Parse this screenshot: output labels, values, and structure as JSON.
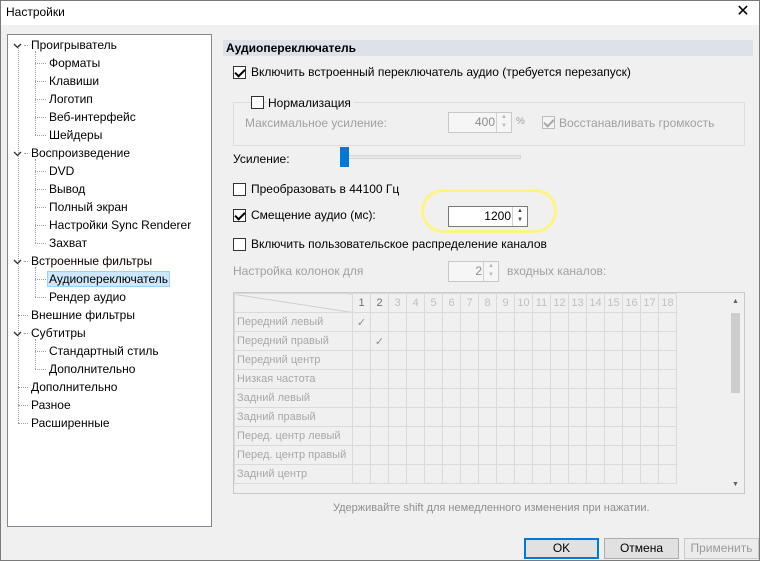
{
  "window": {
    "title": "Настройки",
    "close": "✕"
  },
  "tree": {
    "groups": [
      {
        "label": "Проигрыватель",
        "children": [
          "Форматы",
          "Клавиши",
          "Логотип",
          "Веб-интерфейс",
          "Шейдеры"
        ]
      },
      {
        "label": "Воспроизведение",
        "children": [
          "DVD",
          "Вывод",
          "Полный экран",
          "Настройки Sync Renderer",
          "Захват"
        ]
      },
      {
        "label": "Встроенные фильтры",
        "children": [
          "Аудиопереключатель",
          "Рендер аудио"
        ]
      },
      {
        "label": "Внешние фильтры",
        "children": []
      },
      {
        "label": "Субтитры",
        "children": [
          "Стандартный стиль",
          "Дополнительно"
        ]
      },
      {
        "label": "Дополнительно",
        "children": []
      },
      {
        "label": "Разное",
        "children": []
      },
      {
        "label": "Расширенные",
        "children": []
      }
    ],
    "selected": "Аудиопереключатель"
  },
  "panel": {
    "title": "Аудиопереключатель",
    "enable_switcher": {
      "label": "Включить встроенный переключатель аудио (требуется перезапуск)",
      "checked": true
    },
    "normalization": {
      "label": "Нормализация",
      "checked": false
    },
    "max_gain": {
      "label": "Максимальное усиление:",
      "value": "400",
      "unit": "%"
    },
    "restore_volume": {
      "label": "Восстанавливать громкость",
      "checked": true
    },
    "gain_label": "Усиление:",
    "gain_level": 0.02,
    "convert_44100": {
      "label": "Преобразовать в 44100 Гц",
      "checked": false
    },
    "audio_offset": {
      "label": "Смещение аудио (мс):",
      "checked": true,
      "value": "1200"
    },
    "custom_mapping": {
      "label": "Включить пользовательское распределение каналов",
      "checked": false
    },
    "speaker_config": {
      "label": "Настройка колонок для",
      "value": "2",
      "suffix": "входных каналов:"
    },
    "channel_columns": [
      "1",
      "2",
      "3",
      "4",
      "5",
      "6",
      "7",
      "8",
      "9",
      "10",
      "11",
      "12",
      "13",
      "14",
      "15",
      "16",
      "17",
      "18"
    ],
    "channel_rows": [
      "Передний левый",
      "Передний правый",
      "Передний центр",
      "Низкая частота",
      "Задний левый",
      "Задний правый",
      "Перед. центр левый",
      "Перед. центр правый",
      "Задний центр"
    ],
    "hint": "Удерживайте shift для немедленного изменения при нажатии."
  },
  "buttons": {
    "ok": "OK",
    "cancel": "Отмена",
    "apply": "Применить"
  },
  "colors": {
    "accent": "#0078d7",
    "selection": "#cce8ff",
    "highlight": "#fff27a"
  }
}
